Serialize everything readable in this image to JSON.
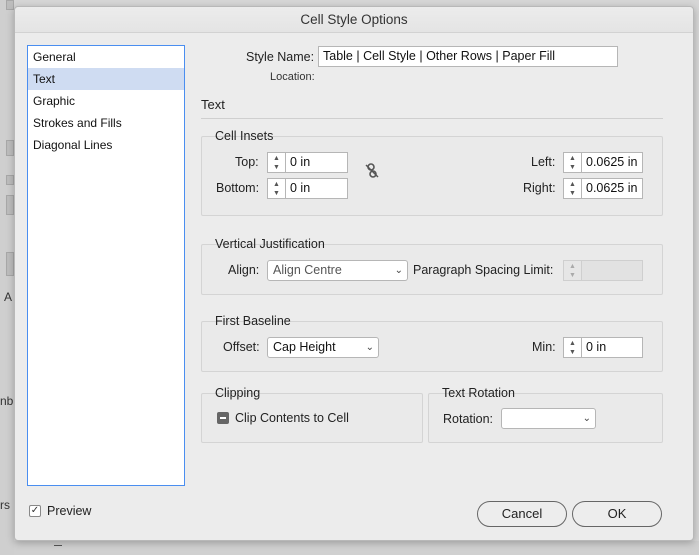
{
  "dialog": {
    "title": "Cell Style Options"
  },
  "sidebar": {
    "items": [
      {
        "label": "General"
      },
      {
        "label": "Text"
      },
      {
        "label": "Graphic"
      },
      {
        "label": "Strokes and Fills"
      },
      {
        "label": "Diagonal Lines"
      }
    ],
    "selected": "Text"
  },
  "style_name": {
    "label": "Style Name:",
    "value": "Table | Cell Style | Other Rows | Paper Fill"
  },
  "location": {
    "label": "Location:"
  },
  "section_title": "Text",
  "cell_insets": {
    "title": "Cell Insets",
    "top_label": "Top:",
    "top_value": "0 in",
    "bottom_label": "Bottom:",
    "bottom_value": "0 in",
    "left_label": "Left:",
    "left_value": "0.0625 in",
    "right_label": "Right:",
    "right_value": "0.0625 in"
  },
  "vertical_justification": {
    "title": "Vertical Justification",
    "align_label": "Align:",
    "align_value": "Align Centre",
    "para_spacing_label": "Paragraph Spacing Limit:"
  },
  "first_baseline": {
    "title": "First Baseline",
    "offset_label": "Offset:",
    "offset_value": "Cap Height",
    "min_label": "Min:",
    "min_value": "0 in"
  },
  "clipping": {
    "title": "Clip​ping",
    "checkbox_label": "Clip Contents to Cell"
  },
  "text_rotation": {
    "title": "Text Rotation",
    "rotation_label": "Rotation:",
    "rotation_value": ""
  },
  "preview": {
    "label": "Preview",
    "checked": true
  },
  "buttons": {
    "cancel": "Cancel",
    "ok": "OK"
  },
  "background": {
    "fragment_a": "A",
    "fragment_nb": "nb",
    "fragment_rs": "rs"
  }
}
